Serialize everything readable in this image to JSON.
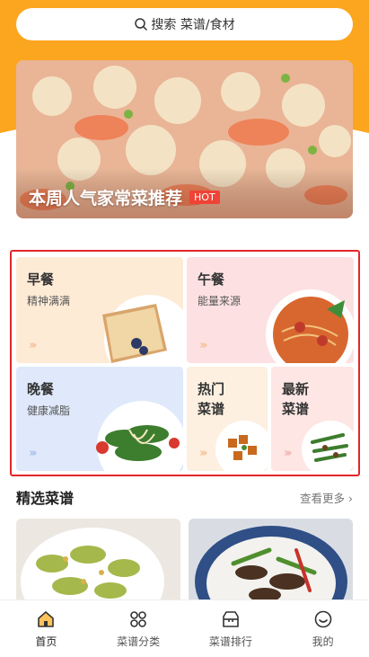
{
  "search": {
    "placeholder": "搜索 菜谱/食材"
  },
  "banner": {
    "title": "本周人气家常菜推荐",
    "badge": "HOT"
  },
  "categories": [
    {
      "title": "早餐",
      "subtitle": "精神满满"
    },
    {
      "title": "午餐",
      "subtitle": "能量来源"
    },
    {
      "title": "晚餐",
      "subtitle": "健康减脂"
    },
    {
      "title_line1": "热门",
      "title_line2": "菜谱"
    },
    {
      "title_line1": "最新",
      "title_line2": "菜谱"
    }
  ],
  "featured": {
    "title": "精选菜谱",
    "more": "查看更多"
  },
  "tabs": [
    {
      "label": "首页",
      "icon": "home-icon"
    },
    {
      "label": "菜谱分类",
      "icon": "category-icon"
    },
    {
      "label": "菜谱排行",
      "icon": "ranking-icon"
    },
    {
      "label": "我的",
      "icon": "profile-icon"
    }
  ],
  "colors": {
    "accent": "#fca51e",
    "hot": "#ef4336",
    "highlight": "#e3262a"
  }
}
